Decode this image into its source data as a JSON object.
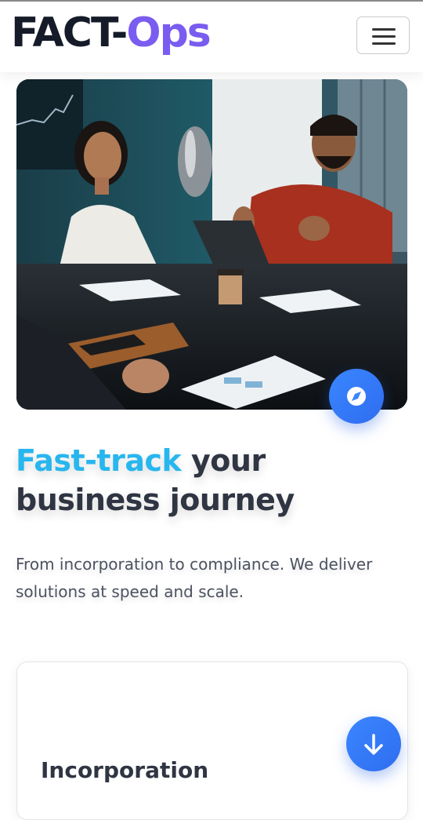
{
  "header": {
    "logo_part1": "FACT-",
    "logo_part2": "Ops",
    "menu_icon": "hamburger-menu-icon"
  },
  "hero": {
    "image_alt": "Two professionals discussing documents at a glass meeting table",
    "compass_icon": "compass-icon",
    "headline_accent": "Fast-track",
    "headline_rest": " your business journey",
    "subtext": "From incorporation to compliance. We deliver solutions at speed and scale."
  },
  "services": {
    "first_card_title": "Incorporation"
  },
  "scroll_down_icon": "arrow-down-icon",
  "colors": {
    "logo_dark": "#151b28",
    "logo_accent": "#7a5cf0",
    "headline_accent": "#28b6ee",
    "fab_blue": "#3a86ff"
  }
}
